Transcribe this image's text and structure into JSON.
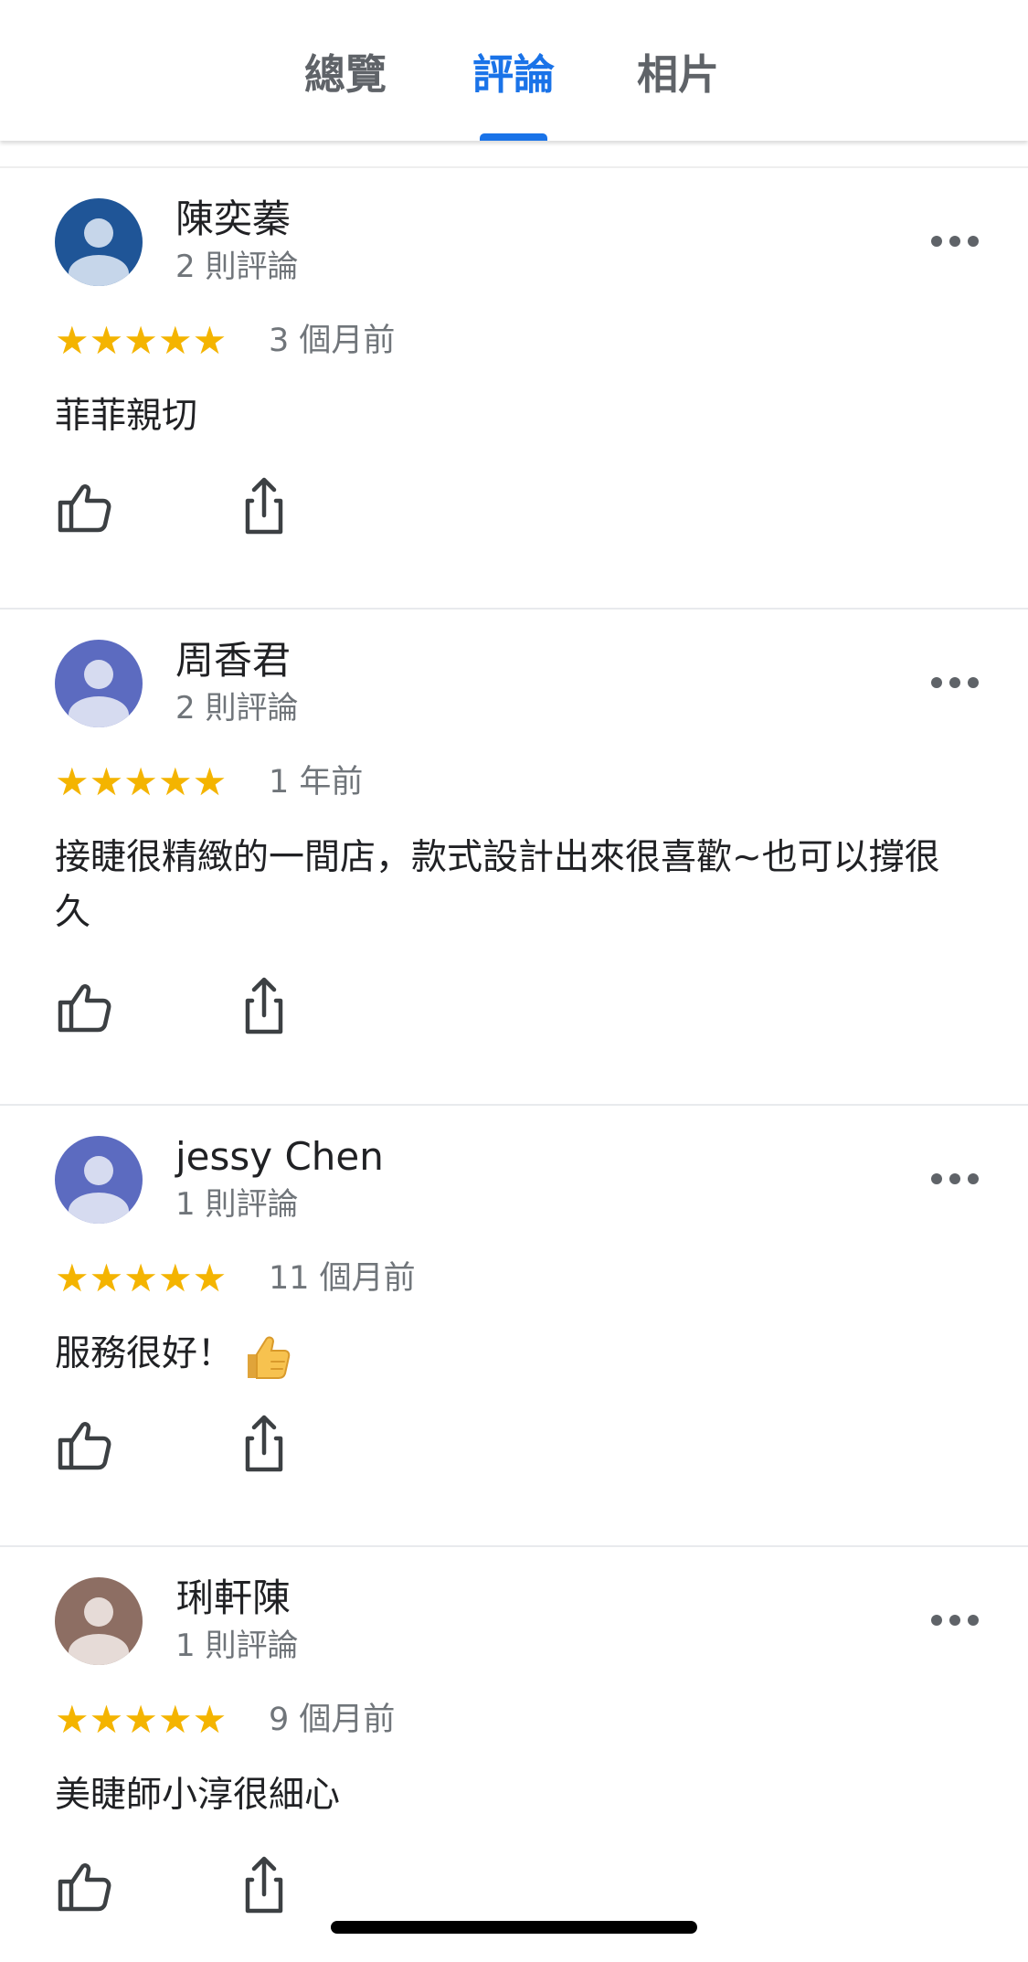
{
  "tabs": [
    {
      "label": "總覽",
      "active": false
    },
    {
      "label": "評論",
      "active": true
    },
    {
      "label": "相片",
      "active": false
    }
  ],
  "colors": {
    "accent": "#1a73e8",
    "star": "#f4b400",
    "text_primary": "#202124",
    "text_secondary": "#70757a"
  },
  "reviews": [
    {
      "author": "陳奕蓁",
      "review_count": "2 則評論",
      "stars": "★★★★★",
      "rating": 5,
      "date": "3 個月前",
      "text": "菲菲親切",
      "avatar_color": "#1f5597",
      "avatar_icon": "person-icon"
    },
    {
      "author": "周香君",
      "review_count": "2 則評論",
      "stars": "★★★★★",
      "rating": 5,
      "date": "1 年前",
      "text": "接睫很精緻的一間店，款式設計出來很喜歡~也可以撐很久",
      "avatar_color": "#5c6bc0",
      "avatar_icon": "person-icon"
    },
    {
      "author": "jessy Chen",
      "review_count": "1 則評論",
      "stars": "★★★★★",
      "rating": 5,
      "date": "11 個月前",
      "text": "服務很好！",
      "emoji": "thumbs-up-emoji",
      "avatar_color": "#5c6bc0",
      "avatar_icon": "person-icon"
    },
    {
      "author": "琍軒陳",
      "review_count": "1 則評論",
      "stars": "★★★★★",
      "rating": 5,
      "date": "9 個月前",
      "text": "美睫師小淳很細心",
      "avatar_color": "#8d6e63",
      "avatar_icon": "person-icon"
    }
  ],
  "icons": {
    "like": "thumbs-up-outline-icon",
    "share": "share-icon",
    "more": "more-horizontal-icon"
  }
}
